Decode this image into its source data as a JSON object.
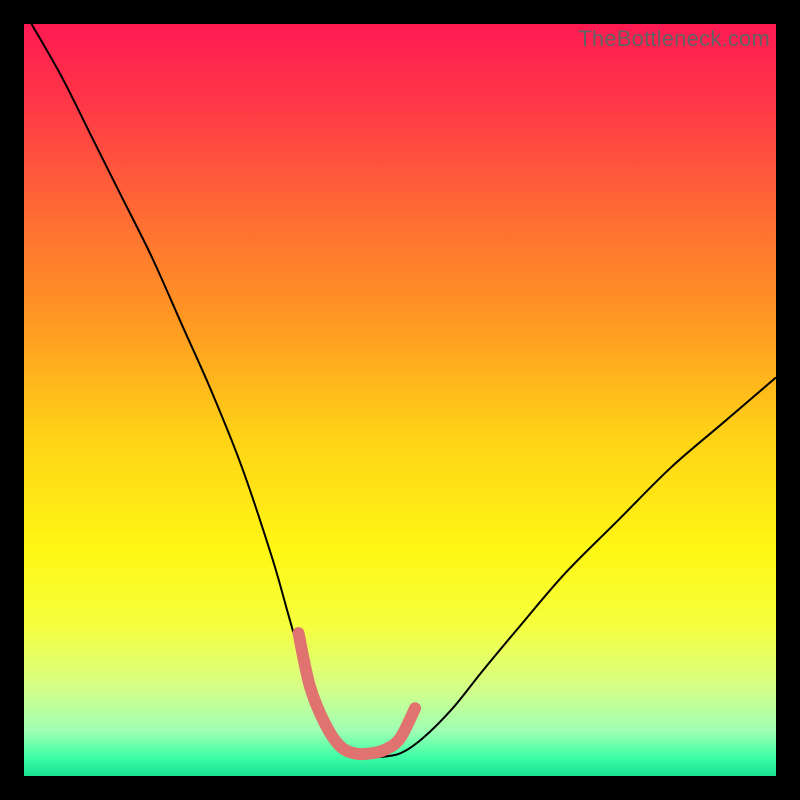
{
  "watermark": "TheBottleneck.com",
  "chart_data": {
    "type": "line",
    "title": "",
    "xlabel": "",
    "ylabel": "",
    "xlim": [
      0,
      100
    ],
    "ylim": [
      0,
      100
    ],
    "grid": false,
    "legend": false,
    "background": {
      "type": "vertical-gradient",
      "stops": [
        {
          "pos": 0.0,
          "color": "#ff1a52"
        },
        {
          "pos": 0.1,
          "color": "#ff3548"
        },
        {
          "pos": 0.25,
          "color": "#ff6a34"
        },
        {
          "pos": 0.4,
          "color": "#ff9a22"
        },
        {
          "pos": 0.55,
          "color": "#ffd316"
        },
        {
          "pos": 0.7,
          "color": "#fff714"
        },
        {
          "pos": 0.8,
          "color": "#f5ff3e"
        },
        {
          "pos": 0.88,
          "color": "#d7ff86"
        },
        {
          "pos": 0.94,
          "color": "#9fffb3"
        },
        {
          "pos": 0.975,
          "color": "#3effa6"
        },
        {
          "pos": 1.0,
          "color": "#19e093"
        }
      ]
    },
    "series": [
      {
        "name": "bottleneck-curve",
        "color": "#000000",
        "stroke_width": 2,
        "x": [
          1,
          5,
          9,
          13,
          17,
          21,
          25,
          29,
          33,
          35,
          37,
          39,
          41,
          43,
          45,
          47,
          50,
          53,
          57,
          61,
          66,
          72,
          79,
          86,
          93,
          100
        ],
        "y": [
          100,
          93,
          85,
          77,
          69,
          60,
          51,
          41,
          29,
          22,
          15,
          9,
          5,
          3,
          2.5,
          2.5,
          3,
          5,
          9,
          14,
          20,
          27,
          34,
          41,
          47,
          53
        ]
      },
      {
        "name": "optimal-marker",
        "color": "#e0736f",
        "stroke_width": 12,
        "linecap": "round",
        "x": [
          36.5,
          38,
          40,
          42,
          44,
          46,
          48,
          50,
          52
        ],
        "y": [
          19,
          12,
          7,
          4,
          3,
          3,
          3.5,
          5,
          9
        ]
      }
    ],
    "annotations": []
  }
}
